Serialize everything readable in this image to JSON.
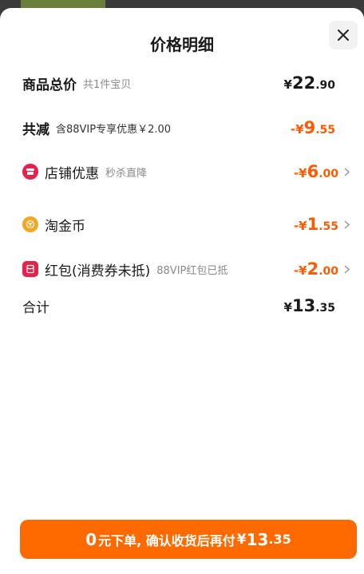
{
  "header": {
    "title": "价格明细"
  },
  "rows": {
    "total": {
      "label": "商品总价",
      "sub": "共1件宝贝",
      "currency": "¥",
      "int": "22",
      "dec": ".90"
    },
    "discount": {
      "label": "共减",
      "sub": "含88VIP专享优惠￥2.00",
      "currency": "-¥",
      "int": "9",
      "dec": ".55"
    },
    "shop": {
      "label": "店铺优惠",
      "sub": "秒杀直降",
      "currency": "-¥",
      "int": "6",
      "dec": ".00"
    },
    "coin": {
      "label": "淘金币",
      "currency": "-¥",
      "int": "1",
      "dec": ".55"
    },
    "redpacket": {
      "label": "红包(消费券未抵)",
      "sub": "88VIP红包已抵",
      "currency": "-¥",
      "int": "2",
      "dec": ".00"
    },
    "sum": {
      "label": "合计",
      "currency": "¥",
      "int": "13",
      "dec": ".35"
    }
  },
  "pay_button": {
    "n": "0",
    "text": "元下单, 确认收货后再付",
    "currency": "¥",
    "int": "13",
    "dec": ".35"
  },
  "colors": {
    "accent": "#ff6a00",
    "price_orange": "#ff5a00",
    "shop_icon": "#e8204a",
    "coin_icon": "#f5a623"
  },
  "icons": {
    "close": "close-icon",
    "chevron": "chevron-right-icon",
    "shop": "shop-icon",
    "coin": "coin-icon",
    "redpacket": "red-packet-icon"
  }
}
